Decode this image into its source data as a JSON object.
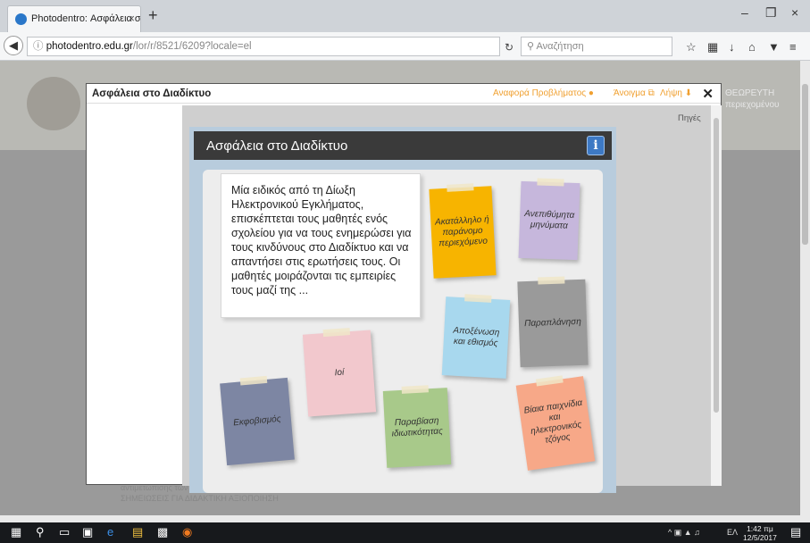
{
  "browser": {
    "tab_title": "Photodentro: Ασφάλεια στο",
    "tab_close": "×",
    "new_tab": "+",
    "url_host": "photodentro.edu.gr",
    "url_path": "/lor/r/8521/6209?locale=el",
    "search_placeholder": "Αναζήτηση",
    "window_controls": [
      "–",
      "❐",
      "×"
    ],
    "toolbar_icons": [
      "star-icon",
      "bookmarks-icon",
      "download-icon",
      "home-icon",
      "pocket-icon",
      "menu-icon"
    ]
  },
  "background": {
    "right_text": "ΘΕΩΡΕΥΤΗ",
    "right_subtext": "περιεχομένου",
    "footer_line1": "ΣΗΜΕΙΩΣΕΙΣ ΓΙΑ ΔΙΔΑΚΤΙΚΗ ΑΞΙΟΠΟΙΗΣΗ",
    "footer_line0": "αντιμετώπισης των κινδύνων που ενέχει ο Διαδίκτυο ... κίνδυνο"
  },
  "modal": {
    "title": "Ασφάλεια στο Διαδίκτυο",
    "report_label": "Αναφορά Προβλήματος",
    "open_label": "Άνοιγμα",
    "download_label": "Λήψη",
    "close": "✕"
  },
  "lesson": {
    "sources_label": "Πηγές",
    "header": "Ασφάλεια στο Διαδίκτυο",
    "info_button": "i",
    "intro_text": "Μία ειδικός από τη Δίωξη Ηλεκτρονικού Εγκλήματος, επισκέπτεται τους μαθητές ενός σχολείου για να τους ενημερώσει για τους κινδύνους στο Διαδίκτυο και να απαντήσει στις ερωτήσεις τους. Οι μαθητές μοιράζονται τις εμπειρίες τους μαζί της ...",
    "notes": [
      {
        "id": "inappropriate",
        "label": "Ακατάλληλο ή παράνομο περιεχόμενο",
        "color": "#f7b400"
      },
      {
        "id": "unwanted",
        "label": "Ανεπιθύμητα μηνύματα",
        "color": "#c6b7dc"
      },
      {
        "id": "deception",
        "label": "Παραπλάνηση",
        "color": "#9a9a9a"
      },
      {
        "id": "isolation",
        "label": "Αποξένωση και εθισμός",
        "color": "#a8d8ee"
      },
      {
        "id": "viruses",
        "label": "Ιοί",
        "color": "#f2c8cd"
      },
      {
        "id": "bullying",
        "label": "Εκφοβισμός",
        "color": "#7d86a3"
      },
      {
        "id": "privacy",
        "label": "Παραβίαση ιδιωτικότητας",
        "color": "#a8c98a"
      },
      {
        "id": "violent-games",
        "label": "Βίαια παιχνίδια και ηλεκτρονικός τζόγος",
        "color": "#f7a888"
      }
    ]
  },
  "taskbar": {
    "language": "ΕΛ",
    "time": "1:42 πμ",
    "date": "12/5/2017"
  }
}
